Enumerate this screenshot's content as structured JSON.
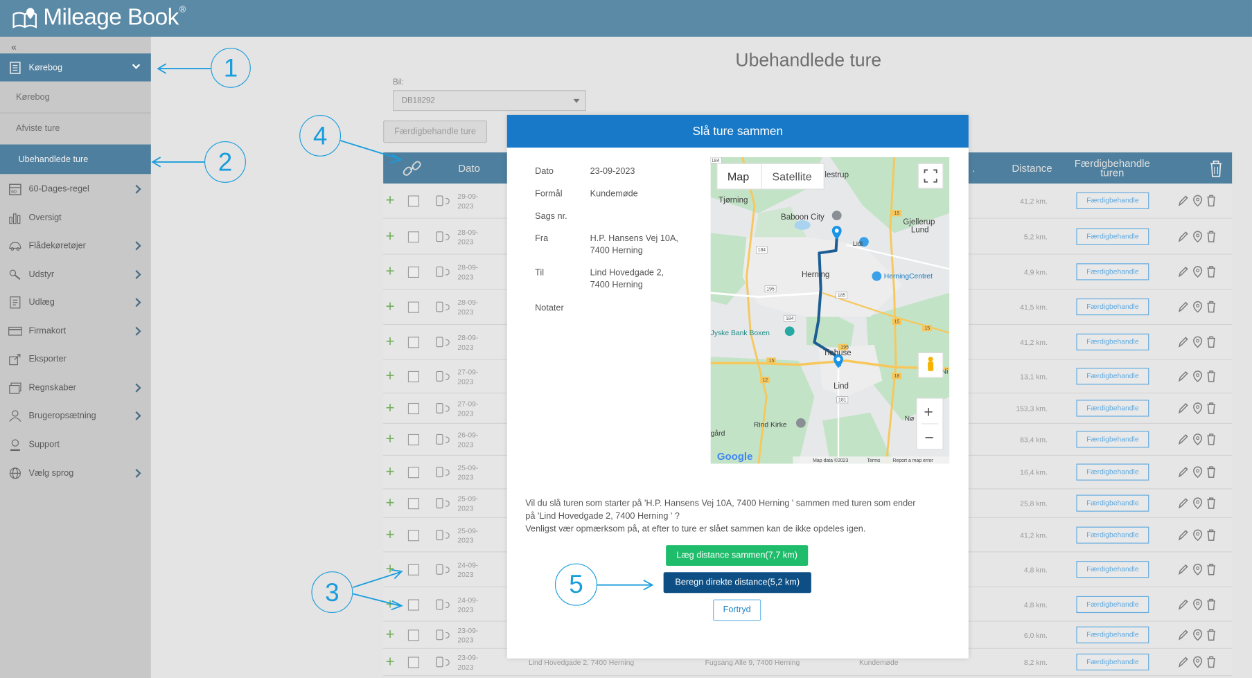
{
  "app": {
    "logo_text": "Mileage Book",
    "reg": "®"
  },
  "sidebar": {
    "collapse": "«",
    "items": [
      {
        "label": "Kørebog",
        "icon": "book-icon",
        "active": true,
        "chevron": "down"
      },
      {
        "label": "Kørebog",
        "sub": true
      },
      {
        "label": "Afviste ture",
        "sub": true
      },
      {
        "label": "Ubehandlede ture",
        "sub": true,
        "selected": true
      },
      {
        "label": "60-Dages-regel",
        "icon": "calendar-icon",
        "chevron": "right"
      },
      {
        "label": "Oversigt",
        "icon": "bar-chart-icon"
      },
      {
        "label": "Flådekøretøjer",
        "icon": "car-icon",
        "chevron": "right"
      },
      {
        "label": "Udstyr",
        "icon": "tools-icon",
        "chevron": "right"
      },
      {
        "label": "Udlæg",
        "icon": "receipt-icon",
        "chevron": "right"
      },
      {
        "label": "Firmakort",
        "icon": "card-icon",
        "chevron": "right"
      },
      {
        "label": "Eksporter",
        "icon": "export-icon"
      },
      {
        "label": "Regnskaber",
        "icon": "accounts-icon",
        "chevron": "right"
      },
      {
        "label": "Brugeropsætning",
        "icon": "user-icon",
        "chevron": "right"
      },
      {
        "label": "Support",
        "icon": "support-icon"
      },
      {
        "label": "Vælg sprog",
        "icon": "globe-icon",
        "chevron": "right"
      }
    ]
  },
  "main": {
    "title": "Ubehandlede ture",
    "bil_label": "Bil:",
    "bil_value": "DB18292",
    "complete_button": "Færdigbehandle ture",
    "table": {
      "headers": {
        "date": "Dato",
        "distance": "Distance",
        "complete": "Færdigbehandle turen",
        "trailing": "."
      },
      "row_button": "Færdigbehandle",
      "rows": [
        {
          "date1": "29-09-",
          "date2": "2023",
          "distance": "41,2 km."
        },
        {
          "date1": "28-09-",
          "date2": "2023",
          "distance": "5,2 km."
        },
        {
          "date1": "28-09-",
          "date2": "2023",
          "distance": "4,9 km."
        },
        {
          "date1": "28-09-",
          "date2": "2023",
          "distance": "41,5 km."
        },
        {
          "date1": "28-09-",
          "date2": "2023",
          "distance": "41,2 km."
        },
        {
          "date1": "27-09-",
          "date2": "2023",
          "distance": "13,1 km."
        },
        {
          "date1": "27-09-",
          "date2": "2023",
          "distance": "153,3 km."
        },
        {
          "date1": "26-09-",
          "date2": "2023",
          "distance": "83,4 km."
        },
        {
          "date1": "25-09-",
          "date2": "2023",
          "distance": "16,4 km."
        },
        {
          "date1": "25-09-",
          "date2": "2023",
          "distance": "25,8 km."
        },
        {
          "date1": "25-09-",
          "date2": "2023",
          "distance": "41,2 km."
        },
        {
          "date1": "24-09-",
          "date2": "2023",
          "distance": "4,8 km."
        },
        {
          "date1": "24-09-",
          "date2": "2023",
          "distance": "4,8 km."
        },
        {
          "date1": "23-09-",
          "date2": "2023",
          "distance": "6,0 km."
        },
        {
          "date1": "23-09-",
          "date2": "2023",
          "distance": "8,2 km.",
          "from": "Lind Hovedgade 2, 7400 Herning",
          "to": "Fugsang Alle 9, 7400 Herning",
          "purpose": "Kundemøde"
        }
      ]
    }
  },
  "modal": {
    "title": "Slå ture sammen",
    "labels": {
      "date": "Dato",
      "purpose": "Formål",
      "case": "Sags nr.",
      "from": "Fra",
      "to": "Til",
      "notes": "Notater"
    },
    "values": {
      "date": "23-09-2023",
      "purpose": "Kundemøde",
      "from1": "H.P. Hansens Vej 10A,",
      "from2": "7400 Herning",
      "to1": "Lind Hovedgade 2,",
      "to2": "7400 Herning"
    },
    "map": {
      "tab_map": "Map",
      "tab_sat": "Satellite",
      "places": {
        "tjorning": "Tjørning",
        "baboon": "Baboon City",
        "gjellerup1": "Gjellerup",
        "gjellerup2": "Lund",
        "herning": "Herning",
        "herningcentret": "HerningCentret",
        "jyske": "Jyske Bank Boxen",
        "tiehuse": "Tiehuse",
        "lind": "Lind",
        "rind": "Rind Kirke",
        "gard": "gård",
        "no": "Nø",
        "n": "Ni",
        "lestrup": "lestrup",
        "lidl": "Lidl"
      },
      "roads": [
        "184",
        "184",
        "195",
        "195",
        "185",
        "15",
        "15",
        "184",
        "15",
        "12",
        "15",
        "18",
        "181"
      ],
      "google": "Google",
      "footer_data": "Map data ©2023",
      "footer_terms": "Terms",
      "footer_report": "Report a map error",
      "zoom_in": "+",
      "zoom_out": "−"
    },
    "confirm_line1": "Vil du slå turen som starter på 'H.P. Hansens Vej 10A, 7400 Herning ' sammen med turen som ender",
    "confirm_line2": "på 'Lind Hovedgade 2, 7400 Herning ' ?",
    "confirm_line3": "Venligst vær opmærksom på, at efter to ture er slået sammen kan de ikke opdeles igen.",
    "btn_add": "Læg distance sammen(7,7 km)",
    "btn_direct": "Beregn direkte distance(5,2 km)",
    "btn_cancel": "Fortryd"
  },
  "annotations": [
    "1",
    "2",
    "3",
    "4",
    "5"
  ],
  "colors": {
    "header": "#5a8aa6",
    "modal_header": "#1779c7",
    "green": "#1fbd6b",
    "dark_blue": "#0d4f84",
    "annotation": "#1a9ddc"
  }
}
